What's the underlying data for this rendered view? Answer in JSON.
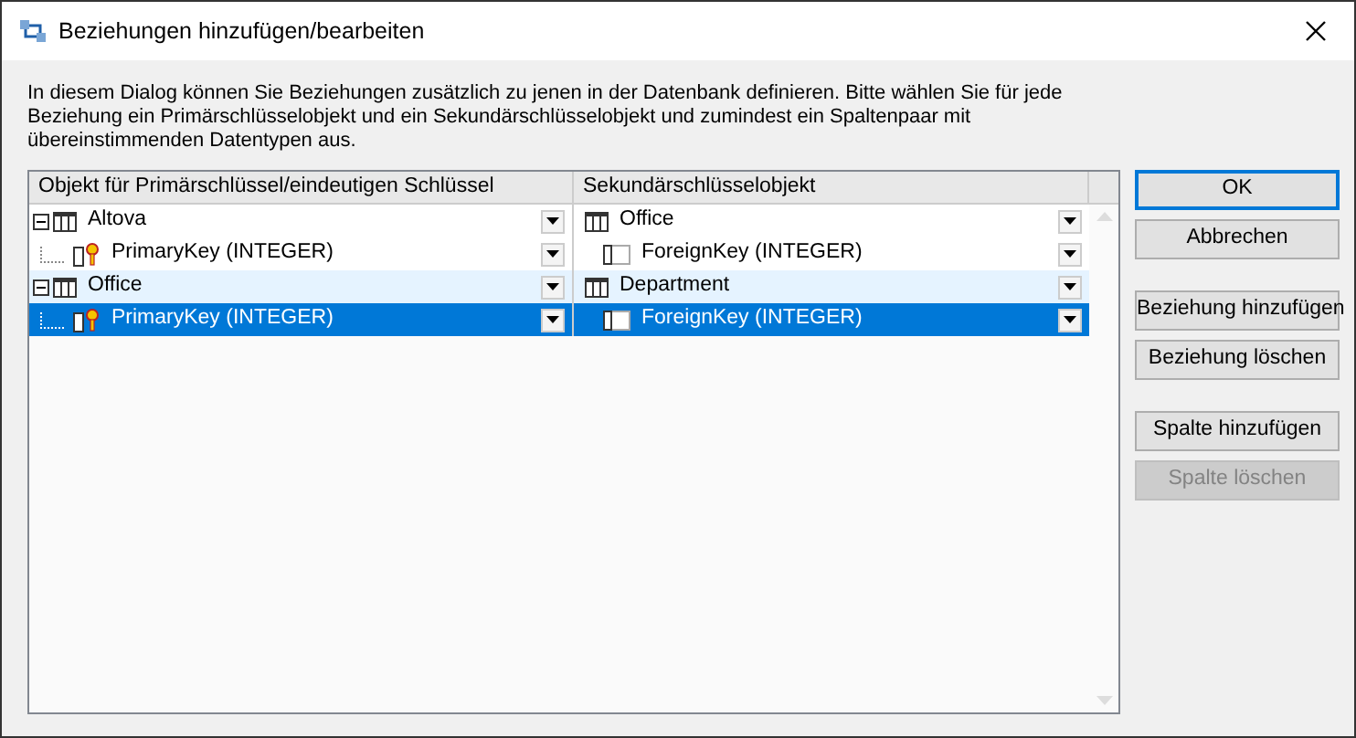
{
  "window": {
    "title": "Beziehungen hinzufügen/bearbeiten"
  },
  "description": "In diesem Dialog können Sie Beziehungen zusätzlich zu jenen in der Datenbank definieren. Bitte wählen Sie für jede Beziehung ein Primärschlüsselobjekt und ein Sekundärschlüsselobjekt und zumindest ein Spaltenpaar mit übereinstimmenden Datentypen aus.",
  "table": {
    "columns": [
      "Objekt für Primärschlüssel/eindeutigen Schlüssel",
      "Sekundärschlüsselobjekt"
    ],
    "groups": [
      {
        "primary": "Altova",
        "foreign": "Office",
        "expanded": true,
        "columns": [
          {
            "primary": "PrimaryKey (INTEGER)",
            "foreign": "ForeignKey (INTEGER)",
            "selected": false
          }
        ]
      },
      {
        "primary": "Office",
        "foreign": "Department",
        "expanded": true,
        "columns": [
          {
            "primary": "PrimaryKey (INTEGER)",
            "foreign": "ForeignKey (INTEGER)",
            "selected": true
          }
        ]
      }
    ]
  },
  "button_groups": [
    [
      {
        "label": "OK",
        "default": true,
        "disabled": false
      },
      {
        "label": "Abbrechen",
        "default": false,
        "disabled": false
      }
    ],
    [
      {
        "label": "Beziehung hinzufügen",
        "default": false,
        "disabled": false
      },
      {
        "label": "Beziehung löschen",
        "default": false,
        "disabled": false
      }
    ],
    [
      {
        "label": "Spalte hinzufügen",
        "default": false,
        "disabled": false
      },
      {
        "label": "Spalte löschen",
        "default": false,
        "disabled": true
      }
    ]
  ]
}
